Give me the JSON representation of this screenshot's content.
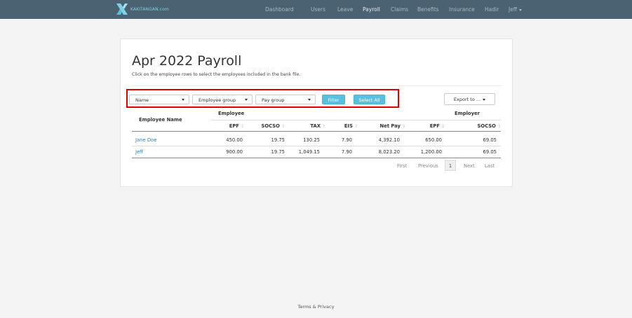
{
  "brand": {
    "name": "KAKITANGAN.com"
  },
  "nav": {
    "items": [
      "Dashboard",
      "Users",
      "Leave",
      "Payroll",
      "Claims",
      "Benefits",
      "Insurance",
      "Hadir"
    ],
    "active": "Payroll",
    "user_label": "Jeff"
  },
  "page": {
    "title": "Apr 2022 Payroll",
    "subtitle": "Click on the employee rows to select the employees included in the bank file."
  },
  "filters": {
    "name_select": "Name",
    "employee_group_select": "Employee group",
    "pay_group_select": "Pay group",
    "filter_button": "Filter",
    "select_all_button": "Select All",
    "export_button": "Export to ..."
  },
  "table": {
    "group_headers": {
      "employee": "Employee",
      "employer": "Employer"
    },
    "name_header": "Employee Name",
    "columns": [
      "EPF",
      "SOCSO",
      "TAX",
      "EIS",
      "Net Pay",
      "EPF",
      "SOCSO"
    ],
    "rows": [
      {
        "name": "Jane Doe",
        "values": [
          "450.00",
          "19.75",
          "130.25",
          "7.90",
          "4,392.10",
          "650.00",
          "69.05"
        ]
      },
      {
        "name": "Jeff",
        "values": [
          "900.00",
          "19.75",
          "1,049.15",
          "7.90",
          "8,023.20",
          "1,200.00",
          "69.05"
        ]
      }
    ]
  },
  "pagination": {
    "first": "First",
    "previous": "Previous",
    "current": "1",
    "next": "Next",
    "last": "Last"
  },
  "footer": {
    "text": "Terms & Privacy"
  },
  "colors": {
    "navbar": "#4a6272",
    "accent": "#5bc0de",
    "highlight_border": "#e00000",
    "link": "#337ab7"
  }
}
